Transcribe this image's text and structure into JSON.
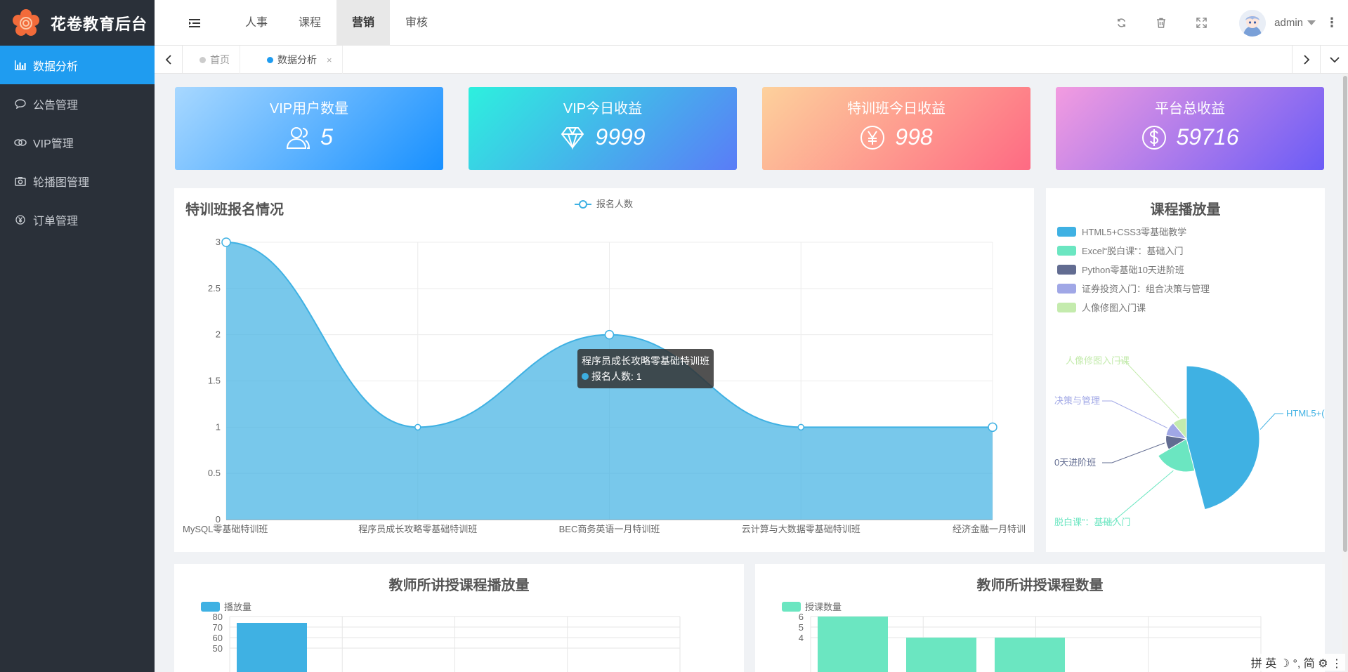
{
  "brand": {
    "title": "花卷教育后台"
  },
  "sidebar": {
    "items": [
      {
        "label": "数据分析",
        "icon": "bar-chart-icon",
        "active": true
      },
      {
        "label": "公告管理",
        "icon": "chat-icon",
        "active": false
      },
      {
        "label": "VIP管理",
        "icon": "link-icon",
        "active": false
      },
      {
        "label": "轮播图管理",
        "icon": "camera-icon",
        "active": false
      },
      {
        "label": "订单管理",
        "icon": "yen-icon",
        "active": false
      }
    ]
  },
  "navbar": {
    "tabs": [
      "人事",
      "课程",
      "营销",
      "审核"
    ],
    "active_tab": "营销",
    "user": "admin"
  },
  "tabsbar": {
    "home_label": "首页",
    "current_label": "数据分析",
    "close_glyph": "×"
  },
  "cards": [
    {
      "title": "VIP用户数量",
      "value": "5",
      "icon": "user-icon",
      "gradient": [
        "#a8d8ff",
        "#1890ff"
      ]
    },
    {
      "title": "VIP今日收益",
      "value": "9999",
      "icon": "diamond-icon",
      "gradient": [
        "#2df0de",
        "#5a7cf7"
      ]
    },
    {
      "title": "特训班今日收益",
      "value": "998",
      "icon": "yen-circle-icon",
      "gradient": [
        "#fdd19c",
        "#fe6a83"
      ]
    },
    {
      "title": "平台总收益",
      "value": "59716",
      "icon": "dollar-circle-icon",
      "gradient": [
        "#f39ce0",
        "#6b5cf6"
      ]
    }
  ],
  "line_panel": {
    "title": "特训班报名情况",
    "legend": "报名人数",
    "tooltip_title": "程序员成长攻略零基础特训班",
    "tooltip_label": "报名人数: 1"
  },
  "pie_panel": {
    "title": "课程播放量",
    "legend": [
      {
        "label": "HTML5+CSS3零基础教学",
        "color": "#3fb1e3"
      },
      {
        "label": "Excel“脱白课”：基础入门",
        "color": "#6be6c1"
      },
      {
        "label": "Python零基础10天进阶班",
        "color": "#626c91"
      },
      {
        "label": "证券投资入门：组合决策与管理",
        "color": "#a0a7e6"
      },
      {
        "label": "人像修图入门课",
        "color": "#c4ebad"
      }
    ],
    "slice_labels": [
      "HTML5+(",
      "脱白课”：基础入门",
      "0天进阶班",
      "决策与管理",
      "人像修图入门课"
    ]
  },
  "bar_panel_1": {
    "title": "教师所讲授课程播放量",
    "legend": "播放量"
  },
  "bar_panel_2": {
    "title": "教师所讲授课程数量",
    "legend": "授课数量"
  },
  "ime": {
    "text": "拼 英 ☽ °, 简 ⚙ ⋮"
  },
  "chart_data": [
    {
      "type": "area",
      "title": "特训班报名情况",
      "categories": [
        "MySQL零基础特训班",
        "程序员成长攻略零基础特训班",
        "BEC商务英语一月特训班",
        "云计算与大数据零基础特训班",
        "经济金融一月特训班"
      ],
      "category_labels": [
        "MySQL零基础特训班",
        "程序员成长攻略零基础特训班",
        "BEC商务英语一月特训班",
        "云计算与大数据零基础特训班",
        "经济金融一月特训"
      ],
      "series": [
        {
          "name": "报名人数",
          "values": [
            3,
            1,
            2,
            1,
            1
          ]
        }
      ],
      "ylim": [
        0,
        3
      ],
      "yticks": [
        "0",
        "0.5",
        "1",
        "1.5",
        "2",
        "2.5",
        "3"
      ],
      "grid": true,
      "legend_position": "top-center",
      "color": "#3fb1e3"
    },
    {
      "type": "pie",
      "title": "课程播放量",
      "rose": true,
      "slices": [
        {
          "label": "HTML5+CSS3零基础教学",
          "value": 74,
          "color": "#3fb1e3"
        },
        {
          "label": "Excel“脱白课”：基础入门",
          "value": 33,
          "color": "#6be6c1"
        },
        {
          "label": "Python零基础10天进阶班",
          "value": 18,
          "color": "#626c91"
        },
        {
          "label": "证券投资入门：组合决策与管理",
          "value": 18,
          "color": "#a0a7e6"
        },
        {
          "label": "人像修图入门课",
          "value": 18,
          "color": "#c4ebad"
        }
      ],
      "legend_position": "top-left"
    },
    {
      "type": "bar",
      "title": "教师所讲授课程播放量",
      "series": [
        {
          "name": "播放量",
          "values": [
            74
          ]
        }
      ],
      "ylim": [
        0,
        80
      ],
      "yticks": [
        "50",
        "60",
        "70",
        "80"
      ],
      "color": "#3fb1e3",
      "legend_position": "top-left"
    },
    {
      "type": "bar",
      "title": "教师所讲授课程数量",
      "series": [
        {
          "name": "授课数量",
          "values": [
            6,
            4,
            4
          ]
        }
      ],
      "ylim": [
        0,
        6
      ],
      "yticks": [
        "4",
        "5",
        "6"
      ],
      "color": "#6be6c1",
      "legend_position": "top-left"
    }
  ]
}
